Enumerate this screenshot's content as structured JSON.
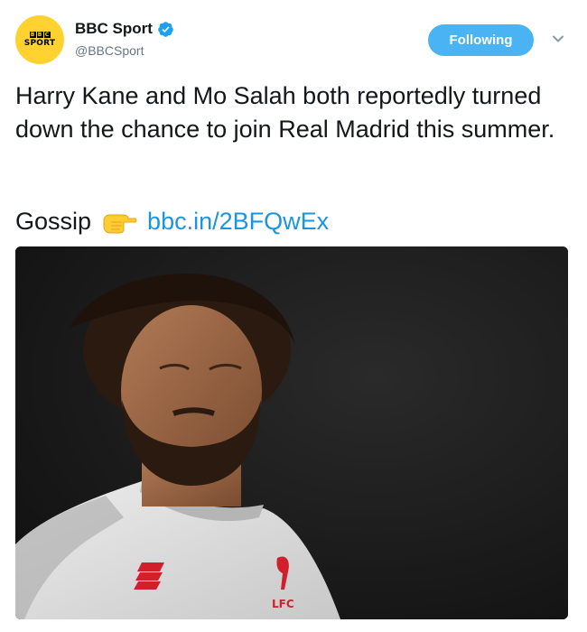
{
  "author": {
    "avatar_icon": "bbc-sport-logo-icon",
    "avatar_bbc": [
      "B",
      "B",
      "C"
    ],
    "avatar_sport": "SPORT",
    "display_name": "BBC Sport",
    "handle": "@BBCSport",
    "verified_icon": "verified-badge-icon"
  },
  "actions": {
    "follow_label": "Following",
    "caret_icon": "chevron-down-icon"
  },
  "tweet": {
    "text": "Harry Kane and Mo Salah both reportedly turned down the chance to join Real Madrid this summer.",
    "gossip_label": "Gossip",
    "pointer_icon": "backhand-index-pointing-right-icon",
    "link_text": "bbc.in/2BFQwEx"
  },
  "media": {
    "badge_text": "LFC",
    "colors": {
      "background": "#1a1a1a",
      "shirt": "#dcdcdc",
      "accent": "#d11f2b"
    }
  },
  "colors": {
    "follow_button": "#4ab3f4",
    "link": "#1b95e0",
    "handle": "#657786",
    "avatar_bg": "#ffd230"
  }
}
